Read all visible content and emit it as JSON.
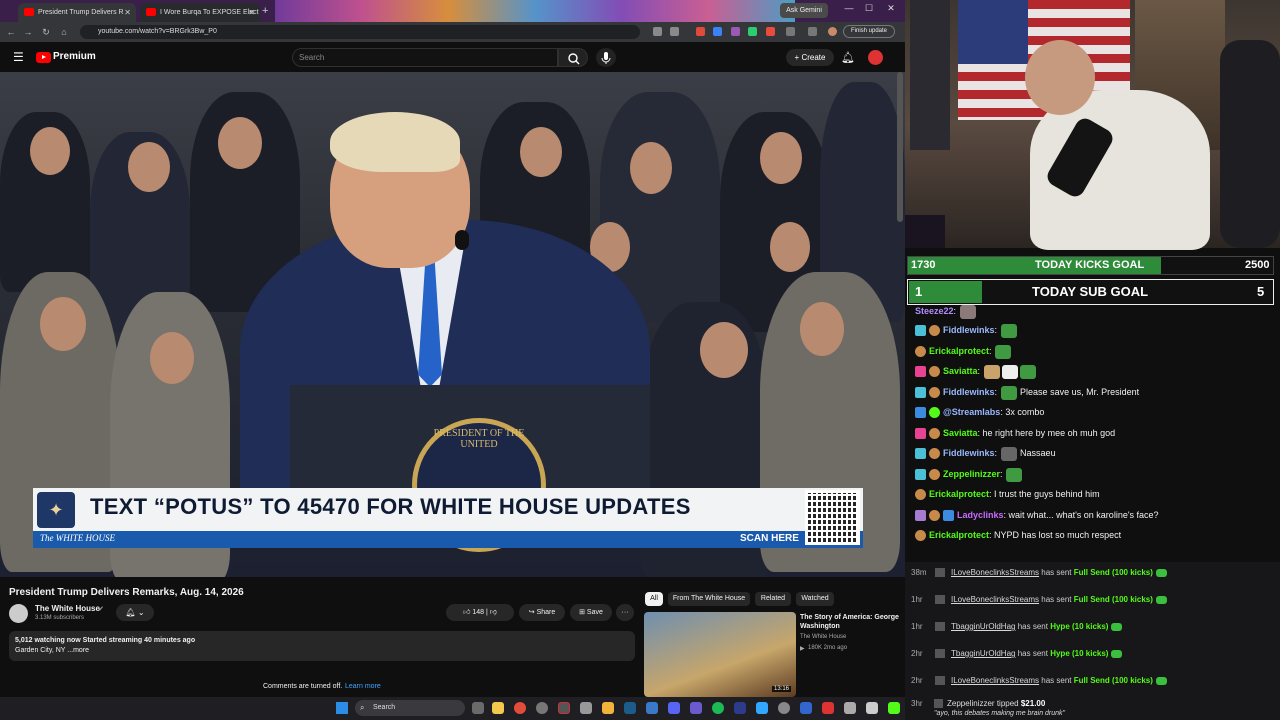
{
  "browser": {
    "tabs": [
      {
        "title": "President Trump Delivers R"
      },
      {
        "title": "I Wore Burqa To EXPOSE Elect"
      }
    ],
    "ask_gemini": "Ask Gemini",
    "url": "youtube.com/watch?v=BRGrk3Bw_P0",
    "finish_update": "Finish update"
  },
  "youtube": {
    "logo": "Premium",
    "search_placeholder": "Search",
    "create": "+ Create",
    "banner": {
      "text": "TEXT “POTUS” TO 45470 FOR WHITE HOUSE UPDATES",
      "brand": "The WHITE HOUSE",
      "scan": "SCAN HERE",
      "seal": "PRESIDENT OF THE UNITED"
    },
    "video_title": "President Trump Delivers Remarks, Aug. 14, 2026",
    "channel": {
      "name": "The White House",
      "subscribers": "3.13M subscribers"
    },
    "actions": {
      "likes": "148",
      "share": "Share",
      "save": "Save",
      "more": "···"
    },
    "description": {
      "line1": "5,012 watching now  Started streaming 40 minutes ago",
      "line2": "Garden City, NY ...more"
    },
    "comments_off": "Comments are turned off.",
    "learn_more": "Learn more",
    "chips": [
      "All",
      "From The White House",
      "Related",
      "Watched"
    ],
    "recommended": {
      "title": "The Story of America: George Washington",
      "channel": "The White House",
      "meta": "180K  2mo ago",
      "duration": "13:16"
    }
  },
  "taskbar": {
    "search": "Search"
  },
  "goals": {
    "kicks": {
      "current": "1730",
      "label": "TODAY KICKS GOAL",
      "target": "2500",
      "fraction": 0.692
    },
    "subs": {
      "current": "1",
      "label": "TODAY SUB GOAL",
      "target": "5",
      "fraction": 0.2
    }
  },
  "chat": [
    {
      "user": "Steeze22",
      "text": "",
      "color": "#b18cff"
    },
    {
      "user": "Fiddlewinks",
      "text": "",
      "color": "#9ab8ff"
    },
    {
      "user": "Erickalprotect",
      "text": "",
      "color": "#53fc18"
    },
    {
      "user": "Saviatta",
      "text": "",
      "color": "#53fc18"
    },
    {
      "user": "Fiddlewinks",
      "text": "Please save us, Mr. President",
      "color": "#9ab8ff"
    },
    {
      "user": "@Streamlabs",
      "text": "3x  combo",
      "color": "#9ab8ff"
    },
    {
      "user": "Saviatta",
      "text": "he right here by mee oh muh god",
      "color": "#53fc18"
    },
    {
      "user": "Fiddlewinks",
      "text": "Nassaeu",
      "color": "#9ab8ff"
    },
    {
      "user": "Zeppelinizzer",
      "text": "",
      "color": "#53fc18"
    },
    {
      "user": "Erickalprotect",
      "text": "I trust the guys behind him",
      "color": "#53fc18"
    },
    {
      "user": "Ladyclinks",
      "text": "wait what... what's on karoline's face?",
      "color": "#c86bff"
    },
    {
      "user": "Erickalprotect",
      "text": "NYPD has lost so much respect",
      "color": "#53fc18"
    }
  ],
  "events": [
    {
      "time": "38m",
      "user": "ILoveBoneclinksStreams",
      "action": "has sent",
      "gift": "Full Send (100 kicks)"
    },
    {
      "time": "1hr",
      "user": "ILoveBoneclinksStreams",
      "action": "has sent",
      "gift": "Full Send (100 kicks)"
    },
    {
      "time": "1hr",
      "user": "TbagginUrOldHag",
      "action": "has sent",
      "gift": "Hype (10 kicks)"
    },
    {
      "time": "2hr",
      "user": "TbagginUrOldHag",
      "action": "has sent",
      "gift": "Hype (10 kicks)"
    },
    {
      "time": "2hr",
      "user": "ILoveBoneclinksStreams",
      "action": "has sent",
      "gift": "Full Send (100 kicks)"
    }
  ],
  "tip": {
    "time": "3hr",
    "user": "Zeppelinizzer",
    "action": "tipped",
    "amount": "$21.00",
    "message": "\"ayo, this debates making me brain drunk\""
  },
  "colors": {
    "youtube_red": "#ff0000",
    "kick_green": "#53fc18",
    "goal_fill": "#2e8b3a",
    "banner_blue": "#1a5aad"
  }
}
